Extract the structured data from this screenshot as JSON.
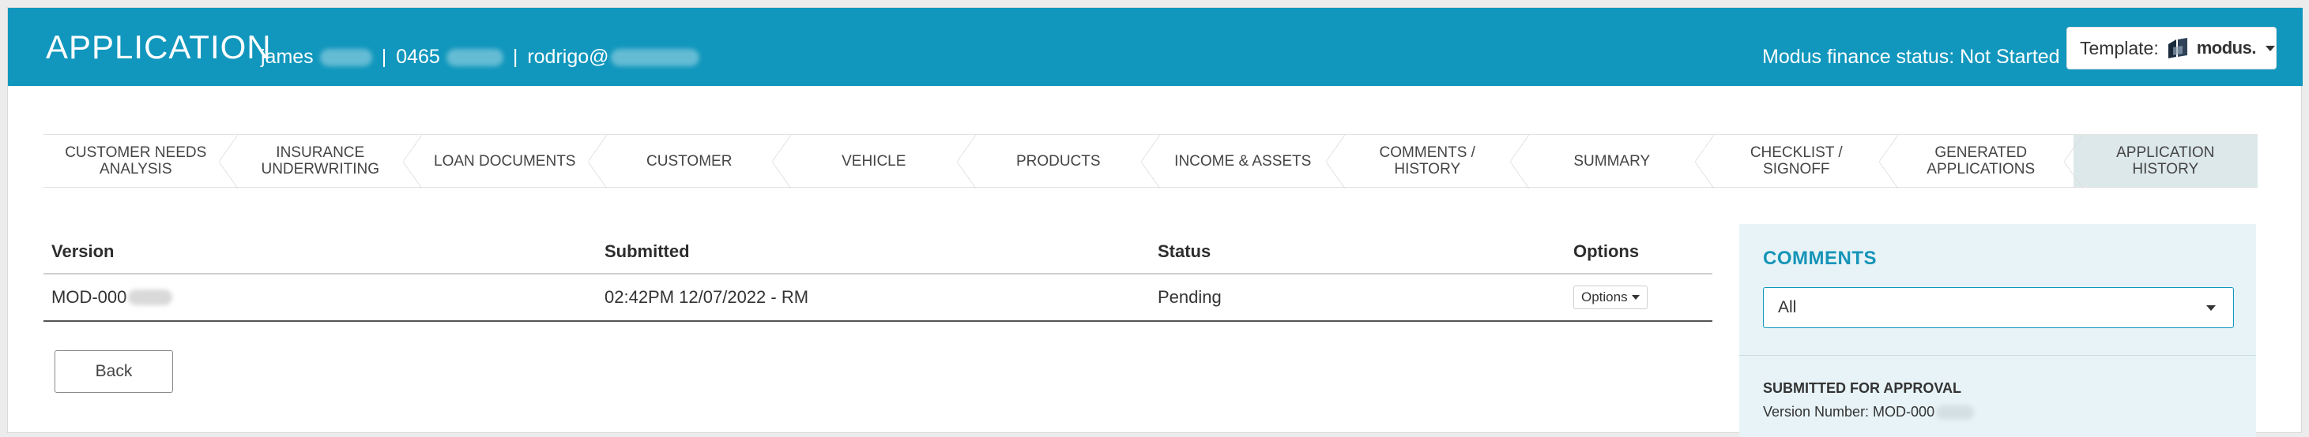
{
  "header": {
    "title": "APPLICATION",
    "customer_name": "james",
    "phone": "0465",
    "email": "rodrigo@",
    "separator": "|",
    "finance_status": "Modus finance status: Not Started",
    "template_label": "Template:",
    "template_brand": "modus.",
    "colors": {
      "header_bg": "#1197bd",
      "active_step_bg": "#dde8ea"
    }
  },
  "steps": [
    {
      "label": "CUSTOMER NEEDS ANALYSIS",
      "active": false
    },
    {
      "label": "INSURANCE UNDERWRITING",
      "active": false
    },
    {
      "label": "LOAN DOCUMENTS",
      "active": false
    },
    {
      "label": "CUSTOMER",
      "active": false
    },
    {
      "label": "VEHICLE",
      "active": false
    },
    {
      "label": "PRODUCTS",
      "active": false
    },
    {
      "label": "INCOME & ASSETS",
      "active": false
    },
    {
      "label": "COMMENTS / HISTORY",
      "active": false
    },
    {
      "label": "SUMMARY",
      "active": false
    },
    {
      "label": "CHECKLIST / SIGNOFF",
      "active": false
    },
    {
      "label": "GENERATED APPLICATIONS",
      "active": false
    },
    {
      "label": "APPLICATION HISTORY",
      "active": true
    }
  ],
  "table": {
    "columns": [
      "Version",
      "Submitted",
      "Status",
      "Options"
    ],
    "rows": [
      {
        "version": "MOD-000",
        "submitted": "02:42PM 12/07/2022 - RM",
        "status": "Pending",
        "options_label": "Options"
      }
    ]
  },
  "back_label": "Back",
  "comments": {
    "title": "COMMENTS",
    "filter_value": "All",
    "entry_heading": "SUBMITTED FOR APPROVAL",
    "entry_line": "Version Number: MOD-000"
  }
}
